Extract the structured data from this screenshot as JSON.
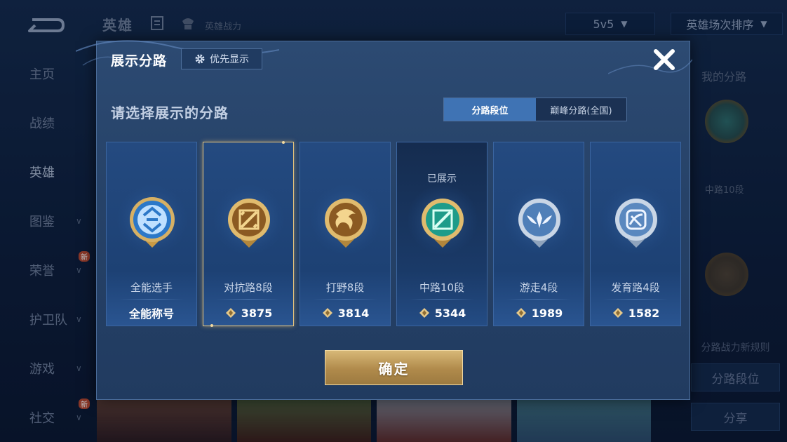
{
  "background": {
    "top_title": "英雄",
    "top_subtitle": "英雄战力",
    "mode_dropdown": "5v5",
    "sort_dropdown": "英雄场次排序",
    "sidebar": [
      {
        "label": "主页",
        "chevron": false,
        "new": false
      },
      {
        "label": "战绩",
        "chevron": false,
        "new": false
      },
      {
        "label": "英雄",
        "chevron": false,
        "new": false,
        "active": true
      },
      {
        "label": "图鉴",
        "chevron": true,
        "new": false
      },
      {
        "label": "荣誉",
        "chevron": true,
        "new": true
      },
      {
        "label": "护卫队",
        "chevron": true,
        "new": false
      },
      {
        "label": "游戏",
        "chevron": true,
        "new": false
      },
      {
        "label": "社交",
        "chevron": true,
        "new": true
      }
    ],
    "new_badge": "新",
    "right_panel": {
      "title": "我的分路",
      "rank": "中路10段",
      "note": "分路战力新规则",
      "lane_rank_button": "分路段位",
      "share_button": "分享"
    }
  },
  "modal": {
    "title": "展示分路",
    "priority_button": "优先显示",
    "prompt": "请选择展示的分路",
    "tabs": [
      {
        "label": "分路段位",
        "active": true
      },
      {
        "label": "巅峰分路(全国)",
        "active": false
      }
    ],
    "shown_label": "已展示",
    "cards": [
      {
        "name": "全能选手",
        "footer": "全能称号",
        "show_power_icon": false,
        "emblem": "all-round",
        "selected": false,
        "featured": false
      },
      {
        "name": "对抗路8段",
        "footer": "3875",
        "show_power_icon": true,
        "emblem": "clash-lane",
        "selected": true,
        "featured": false
      },
      {
        "name": "打野8段",
        "footer": "3814",
        "show_power_icon": true,
        "emblem": "jungle",
        "selected": false,
        "featured": false
      },
      {
        "name": "中路10段",
        "footer": "5344",
        "show_power_icon": true,
        "emblem": "mid-lane",
        "selected": false,
        "featured": true
      },
      {
        "name": "游走4段",
        "footer": "1989",
        "show_power_icon": true,
        "emblem": "roam",
        "selected": false,
        "featured": false
      },
      {
        "name": "发育路4段",
        "footer": "1582",
        "show_power_icon": true,
        "emblem": "farm-lane",
        "selected": false,
        "featured": false
      }
    ],
    "confirm_button": "确定"
  },
  "colors": {
    "accent_gold": "#e9c67c",
    "tab_active": "#3f73b4",
    "modal_bg": "#264268"
  }
}
